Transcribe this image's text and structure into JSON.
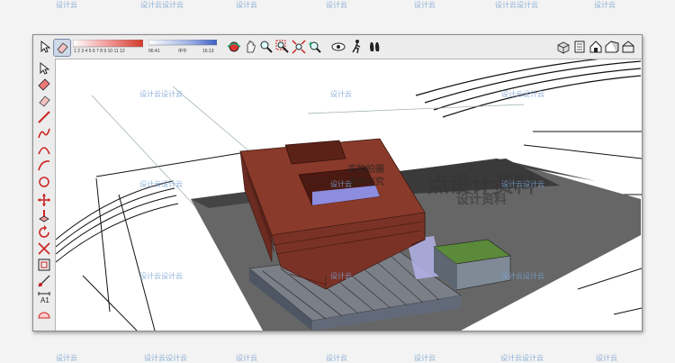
{
  "watermark": {
    "text": "设计云",
    "repeat_text": "设计云设计云",
    "center_small_1": "实物拍摄",
    "center_small_2": "盗用必究",
    "center_big": "点设计资料",
    "center_sub": "设计资料",
    "color": "#6f9fd8"
  },
  "toolbar": {
    "shadow_scale_labels": "1 2 3 4 5 6 7 8 9 10 11 12",
    "time_start": "06:41",
    "time_mid": "中午",
    "time_end": "16:13",
    "icons": [
      "select-icon",
      "eraser-icon",
      "gradient-bar",
      "time-slider",
      "orbit-icon",
      "pan-icon",
      "zoom-icon",
      "zoom-window-icon",
      "zoom-extents-icon",
      "previous-view-icon",
      "position-camera-icon",
      "walk-icon",
      "look-around-icon",
      "iso-view-icon",
      "top-view-icon",
      "front-view-icon",
      "right-view-icon",
      "back-view-icon"
    ]
  },
  "left_tools": [
    "select-icon",
    "paint-icon",
    "eraser-icon",
    "rectangle-icon",
    "line-icon",
    "circle-icon",
    "arc-icon",
    "polygon-icon",
    "freehand-icon",
    "move-icon",
    "pushpull-icon",
    "rotate-icon",
    "followme-icon",
    "scale-icon",
    "offset-icon",
    "tape-icon",
    "dimension-icon",
    "protractor-icon",
    "text-icon",
    "axes-icon",
    "3dtext-icon",
    "section-icon",
    "orbit-icon",
    "pan-icon",
    "zoom-icon"
  ],
  "colors": {
    "building_roof": "#8a3a2a",
    "building_side": "#6b2b20",
    "ground": "#6a6a6a",
    "green_roof": "#5b8b3a",
    "glass": "#8d8de0"
  }
}
